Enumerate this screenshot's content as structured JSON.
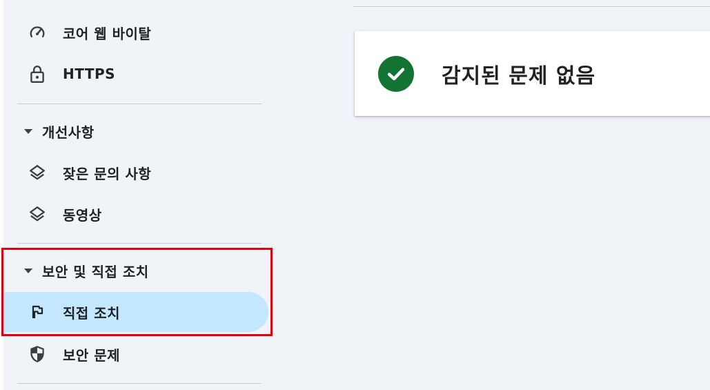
{
  "sidebar": {
    "items_top": [
      {
        "label": "코어 웹 바이탈",
        "icon": "speedometer-icon"
      },
      {
        "label": "HTTPS",
        "icon": "lock-icon"
      }
    ],
    "sections": [
      {
        "title": "개선사항",
        "items": [
          {
            "label": "잦은 문의 사항",
            "icon": "layers-icon"
          },
          {
            "label": "동영상",
            "icon": "layers-icon"
          }
        ]
      },
      {
        "title": "보안 및 직접 조치",
        "items": [
          {
            "label": "직접 조치",
            "icon": "flag-icon",
            "selected": true
          },
          {
            "label": "보안 문제",
            "icon": "shield-icon"
          }
        ]
      }
    ]
  },
  "main": {
    "status_card": {
      "title": "감지된 문제 없음",
      "icon": "check-circle-icon"
    }
  },
  "colors": {
    "background": "#f0f4f9",
    "selected": "#c2e7ff",
    "success": "#137333",
    "highlight": "#e3000f"
  }
}
